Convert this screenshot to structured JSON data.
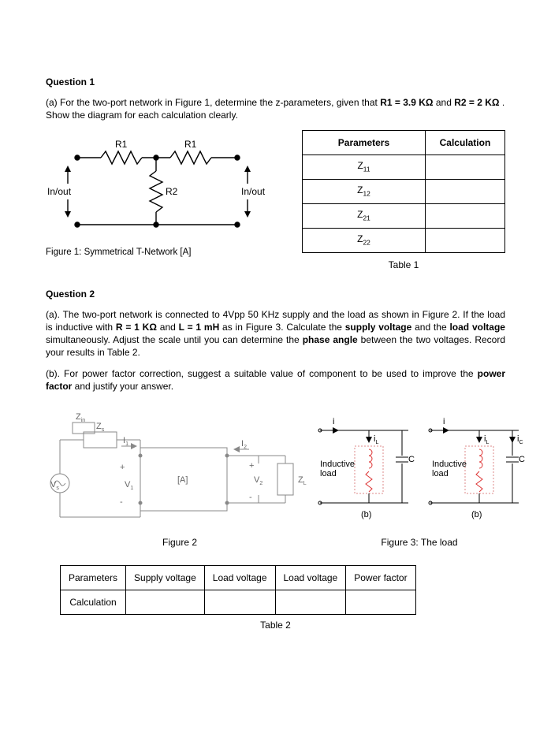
{
  "q1": {
    "heading": "Question 1",
    "para_prefix": "(a) For the two-port network in Figure 1, determine the z-parameters, given that ",
    "r1": "R1 = 3.9 KΩ",
    "middle": " and ",
    "r2": "R2 = 2 KΩ",
    "suffix": " . Show the diagram for each calculation clearly.",
    "fig1_caption": "Figure 1: Symmetrical T-Network [A]",
    "fig1": {
      "R1a": "R1",
      "R1b": "R1",
      "R2": "R2",
      "left_port": "In/out",
      "right_port": "In/out"
    },
    "tbl1": {
      "header_params": "Parameters",
      "header_calc": "Calculation",
      "rows": [
        "Z",
        "Z",
        "Z",
        "Z"
      ],
      "subs": [
        "11",
        "12",
        "21",
        "22"
      ],
      "caption": "Table 1"
    }
  },
  "q2": {
    "heading": "Question 2",
    "para_a_pre": "(a). The two-port network is connected to 4Vpp 50 KHz supply and the load as shown in Figure 2. If the load is inductive with ",
    "R": "R = 1 KΩ",
    "and1": " and ",
    "L": "L = 1 mH",
    "mid1": " as in Figure 3. Calculate the ",
    "supply_v": "supply voltage",
    "mid2": " and the ",
    "load_v": "load voltage",
    "mid3": " simultaneously. Adjust the scale until you can determine the ",
    "phase": "phase angle",
    "end1": " between the two voltages. Record your results in Table 2.",
    "para_b_pre": "(b). For power factor correction, suggest a suitable value of component to be used to improve the ",
    "pf": "power factor",
    "para_b_end": " and justify your answer.",
    "fig2_caption": "Figure 2",
    "fig3_caption": "Figure 3: The load",
    "fig2": {
      "Zs": "Z",
      "Zs_sub": "s",
      "Zin": "Z",
      "Zin_sub": "in",
      "Vs": "V",
      "Vs_sub": "s",
      "V1": "V",
      "V1_sub": "1",
      "V2": "V",
      "V2_sub": "2",
      "I1": "I",
      "I1_sub": "1",
      "I2": "I",
      "I2_sub": "2",
      "ZL": "Z",
      "ZL_sub": "L",
      "A": "[A]"
    },
    "fig3": {
      "i": "i",
      "iL": "i",
      "iL_sub": "L",
      "iC": "i",
      "iC_sub": "C",
      "C": "C",
      "ind": "Inductive",
      "load": "load",
      "sub_b": "(b)"
    },
    "tbl2": {
      "header": [
        "Parameters",
        "Supply voltage",
        "Load voltage",
        "Load voltage",
        "Power factor"
      ],
      "row_label": "Calculation",
      "caption": "Table 2"
    }
  }
}
